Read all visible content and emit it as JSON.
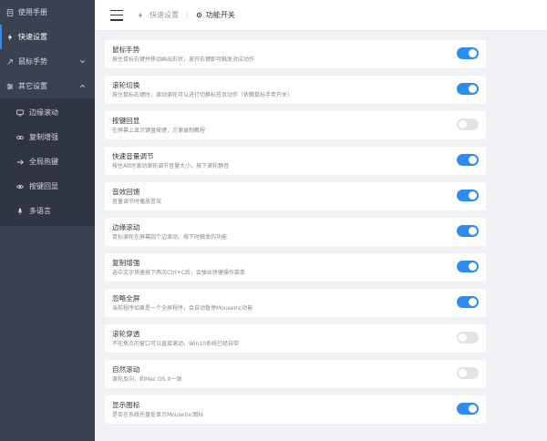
{
  "sidebar": {
    "items": [
      {
        "label": "使用手册",
        "icon": "document-icon"
      },
      {
        "label": "快速设置",
        "icon": "bolt-icon",
        "active": true
      },
      {
        "label": "鼠标手势",
        "icon": "mouse-gesture-icon",
        "expandable": true
      },
      {
        "label": "其它设置",
        "icon": "settings-icon",
        "expanded": true
      }
    ],
    "subitems": [
      {
        "label": "边缘滚动",
        "icon": "monitor-icon"
      },
      {
        "label": "复制增强",
        "icon": "link-icon"
      },
      {
        "label": "全局热键",
        "icon": "hotkey-icon"
      },
      {
        "label": "按键回显",
        "icon": "eye-icon"
      },
      {
        "label": "多语言",
        "icon": "microphone-icon"
      }
    ]
  },
  "header": {
    "breadcrumb": {
      "parent": "快速设置",
      "current": "功能开关"
    }
  },
  "features": [
    {
      "title": "鼠标手势",
      "desc": "按住鼠标右键并移动画出形状，放开右键即可触发对应动作",
      "enabled": true
    },
    {
      "title": "滚轮切换",
      "desc": "按住鼠标右键时，滚动滚轮可以进行切换标签页动作（依赖鼠标手势开关）",
      "enabled": true
    },
    {
      "title": "按键回显",
      "desc": "在屏幕上显示键盘按键，方便录制教程",
      "enabled": false
    },
    {
      "title": "快速音量调节",
      "desc": "按住Alt时滚动滚轮调节音量大小，按下滚轮静音",
      "enabled": true
    },
    {
      "title": "音效回馈",
      "desc": "音量调节时播放音效",
      "enabled": true
    },
    {
      "title": "边缘滚动",
      "desc": "鼠标滚轮在屏幕四个边滚动、按下时触发的功能",
      "enabled": true
    },
    {
      "title": "复制增强",
      "desc": "选中文字快速按下两次Ctrl+C后，会弹出快捷操作菜单",
      "enabled": true
    },
    {
      "title": "忽略全屏",
      "desc": "当前程序如果是一个全屏程序，会自动暂停MouseInc功能",
      "enabled": true
    },
    {
      "title": "滚轮穿透",
      "desc": "不在焦点的窗口可以直接滚动，Win10系统已经自带",
      "enabled": false
    },
    {
      "title": "自然滚动",
      "desc": "滚轮反向，和Mac OS X一致",
      "enabled": false
    },
    {
      "title": "显示图标",
      "desc": "是否在系统托盘处显示MouseInc图标",
      "enabled": true
    }
  ],
  "colors": {
    "accent": "#2d8cf0",
    "sidebar_bg": "#3a4150",
    "submenu_bg": "#2f3542",
    "toggle_off": "#e2e3e5"
  }
}
